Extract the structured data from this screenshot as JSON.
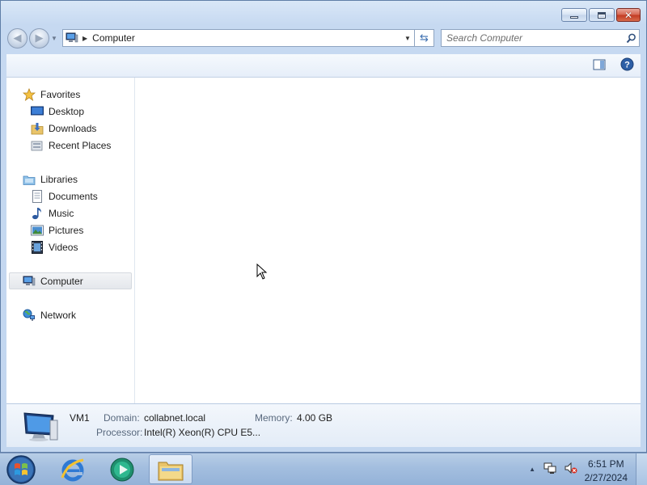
{
  "window": {
    "address": {
      "location": "Computer"
    },
    "search": {
      "placeholder": "Search Computer"
    }
  },
  "nav_pane": {
    "favorites": {
      "label": "Favorites",
      "items": [
        "Desktop",
        "Downloads",
        "Recent Places"
      ]
    },
    "libraries": {
      "label": "Libraries",
      "items": [
        "Documents",
        "Music",
        "Pictures",
        "Videos"
      ]
    },
    "computer": "Computer",
    "network": "Network"
  },
  "details": {
    "name": "VM1",
    "domain_label": "Domain:",
    "domain_value": "collabnet.local",
    "memory_label": "Memory:",
    "memory_value": "4.00 GB",
    "processor_label": "Processor:",
    "processor_value": "Intel(R) Xeon(R) CPU E5..."
  },
  "taskbar": {
    "time": "6:51 PM",
    "date": "2/27/2024"
  },
  "colors": {
    "frame": "#c2d6ef",
    "taskbar": "#a3bedf",
    "selection": "#e4e7ec"
  }
}
